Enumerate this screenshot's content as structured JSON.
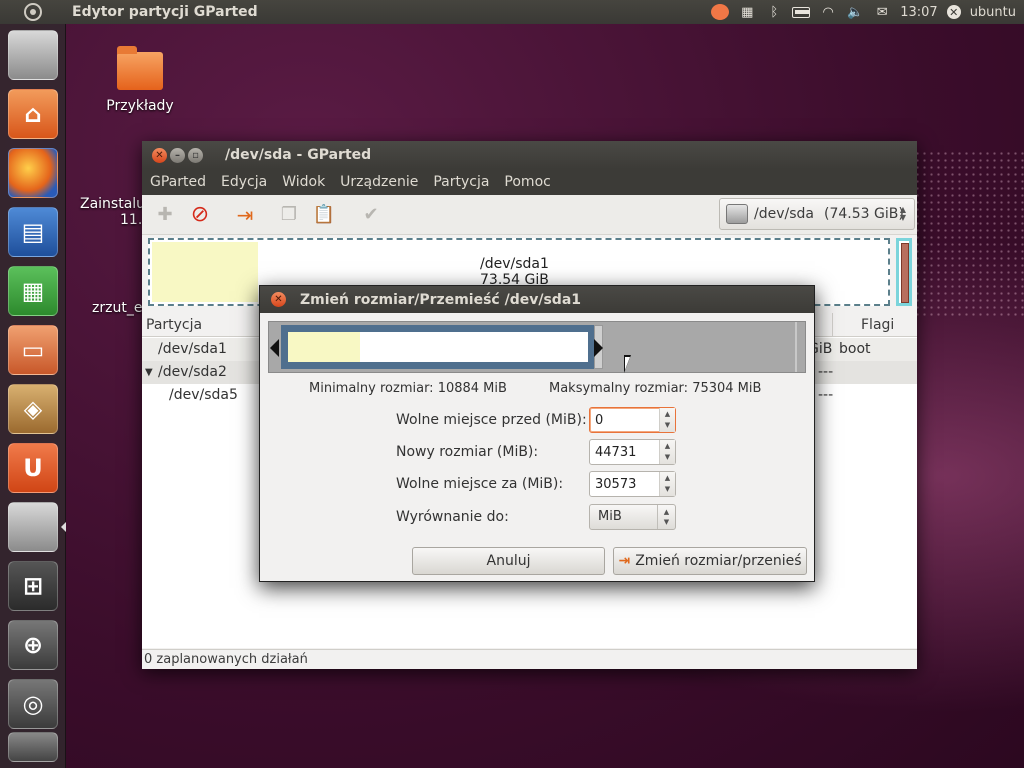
{
  "top_panel": {
    "app_title": "Edytor partycji GParted",
    "clock": "13:07",
    "user": "ubuntu"
  },
  "desktop": {
    "icons": [
      {
        "label": "Przykłady"
      },
      {
        "label": "Zainstalu"
      },
      {
        "label": "11."
      },
      {
        "label": "zrzut_e"
      }
    ]
  },
  "window": {
    "title": "/dev/sda - GParted",
    "menu": [
      "GParted",
      "Edycja",
      "Widok",
      "Urządzenie",
      "Partycja",
      "Pomoc"
    ],
    "device_selector": {
      "device": "/dev/sda",
      "size": "(74.53 GiB)"
    },
    "disk_map": {
      "name": "/dev/sda1",
      "size": "73.54 GiB"
    },
    "columns": {
      "partition": "Partycja",
      "flags": "Flagi"
    },
    "rows": [
      {
        "name": "/dev/sda1",
        "size_tail": "GiB",
        "flags": "boot"
      },
      {
        "name": "/dev/sda2",
        "dash": "---"
      },
      {
        "name": "/dev/sda5",
        "dash": "---"
      }
    ],
    "status": "0 zaplanowanych działań"
  },
  "dialog": {
    "title": "Zmień rozmiar/Przemieść /dev/sda1",
    "min_size": "Minimalny rozmiar: 10884 MiB",
    "max_size": "Maksymalny rozmiar: 75304 MiB",
    "fields": {
      "free_before": {
        "label": "Wolne miejsce przed (MiB):",
        "value": "0"
      },
      "new_size": {
        "label": "Nowy rozmiar (MiB):",
        "value": "44731"
      },
      "free_after": {
        "label": "Wolne miejsce za (MiB):",
        "value": "30573"
      },
      "align": {
        "label": "Wyrównanie do:",
        "value": "MiB"
      }
    },
    "buttons": {
      "cancel": "Anuluj",
      "resize": "Zmień rozmiar/przenieś"
    }
  },
  "colors": {
    "accent_orange": "#e0681c",
    "partition_border": "#4f6f8e",
    "used_space": "#f8f8c4"
  }
}
